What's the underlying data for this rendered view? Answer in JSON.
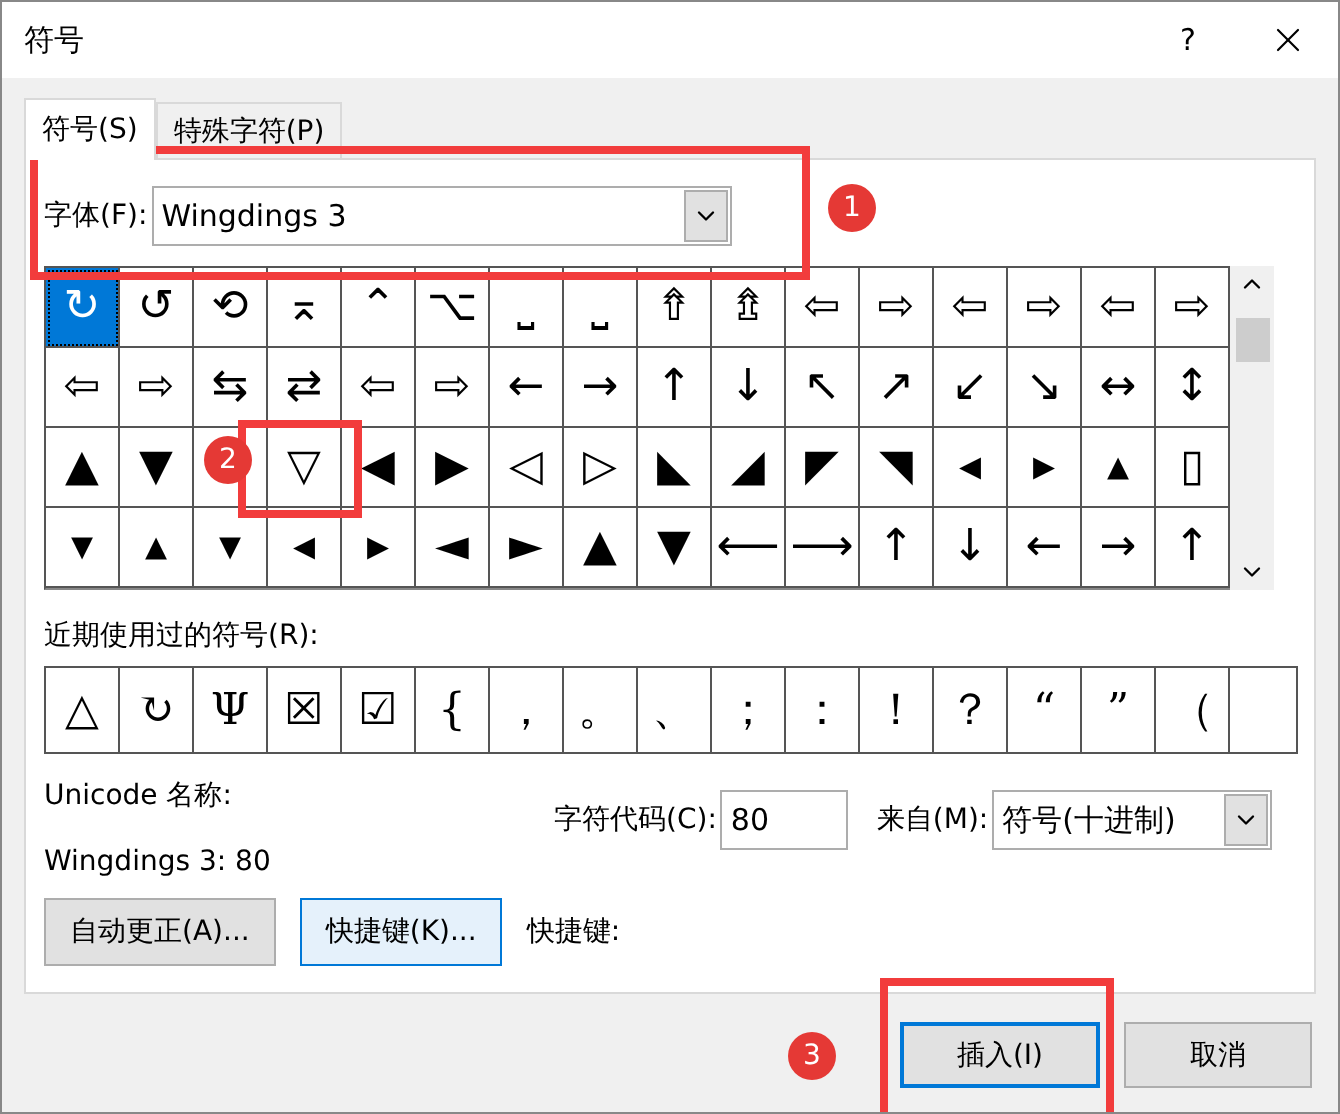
{
  "window": {
    "title": "符号",
    "help": "?"
  },
  "tabs": [
    {
      "label": "符号(S)",
      "selected": true
    },
    {
      "label": "特殊字符(P)",
      "selected": false
    }
  ],
  "font": {
    "label": "字体(F):",
    "value": "Wingdings 3"
  },
  "symbol_grid": {
    "rows": [
      [
        {
          "glyph": "↻",
          "selected": true
        },
        {
          "glyph": "↺",
          "selected": false
        },
        {
          "glyph": "⟲",
          "selected": false
        },
        {
          "glyph": "⌅",
          "selected": false
        },
        {
          "glyph": "⌃",
          "selected": false
        },
        {
          "glyph": "⌥",
          "selected": false
        },
        {
          "glyph": "⎵",
          "selected": false
        },
        {
          "glyph": "⎵",
          "selected": false
        },
        {
          "glyph": "⇮",
          "selected": false
        },
        {
          "glyph": "⇯",
          "selected": false
        },
        {
          "glyph": "⇦",
          "selected": false
        },
        {
          "glyph": "⇨",
          "selected": false
        },
        {
          "glyph": "⇦",
          "selected": false
        },
        {
          "glyph": "⇨",
          "selected": false
        },
        {
          "glyph": "⇦",
          "selected": false
        },
        {
          "glyph": "⇨",
          "selected": false
        }
      ],
      [
        {
          "glyph": "⇦",
          "selected": false
        },
        {
          "glyph": "⇨",
          "selected": false
        },
        {
          "glyph": "⇆",
          "selected": false
        },
        {
          "glyph": "⇄",
          "selected": false
        },
        {
          "glyph": "⇦",
          "selected": false
        },
        {
          "glyph": "⇨",
          "selected": false
        },
        {
          "glyph": "←",
          "selected": false
        },
        {
          "glyph": "→",
          "selected": false
        },
        {
          "glyph": "↑",
          "selected": false
        },
        {
          "glyph": "↓",
          "selected": false
        },
        {
          "glyph": "↖",
          "selected": false
        },
        {
          "glyph": "↗",
          "selected": false
        },
        {
          "glyph": "↙",
          "selected": false
        },
        {
          "glyph": "↘",
          "selected": false
        },
        {
          "glyph": "↔",
          "selected": false
        },
        {
          "glyph": "↕",
          "selected": false
        }
      ],
      [
        {
          "glyph": "▲",
          "selected": false
        },
        {
          "glyph": "▼",
          "selected": false
        },
        {
          "selected": false
        },
        {
          "glyph": "▽",
          "selected": false
        },
        {
          "glyph": "◀",
          "selected": false
        },
        {
          "glyph": "▶",
          "selected": false
        },
        {
          "glyph": "◁",
          "selected": false
        },
        {
          "glyph": "▷",
          "selected": false
        },
        {
          "glyph": "◣",
          "selected": false
        },
        {
          "glyph": "◢",
          "selected": false
        },
        {
          "glyph": "◤",
          "selected": false
        },
        {
          "glyph": "◥",
          "selected": false
        },
        {
          "glyph": "◂",
          "selected": false
        },
        {
          "glyph": "▸",
          "selected": false
        },
        {
          "glyph": "▴",
          "selected": false
        },
        {
          "glyph": "▯",
          "selected": false
        }
      ],
      [
        {
          "glyph": "▾",
          "selected": false
        },
        {
          "glyph": "▴",
          "selected": false
        },
        {
          "glyph": "▾",
          "selected": false
        },
        {
          "glyph": "◂",
          "selected": false
        },
        {
          "glyph": "▸",
          "selected": false
        },
        {
          "glyph": "◄",
          "selected": false
        },
        {
          "glyph": "►",
          "selected": false
        },
        {
          "glyph": "▲",
          "selected": false
        },
        {
          "glyph": "▼",
          "selected": false
        },
        {
          "glyph": "⟵",
          "selected": false
        },
        {
          "glyph": "⟶",
          "selected": false
        },
        {
          "glyph": "↑",
          "selected": false
        },
        {
          "glyph": "↓",
          "selected": false
        },
        {
          "glyph": "←",
          "selected": false
        },
        {
          "glyph": "→",
          "selected": false
        },
        {
          "glyph": "↑",
          "selected": false
        }
      ]
    ]
  },
  "recent": {
    "label": "近期使用过的符号(R):",
    "symbols": [
      "△",
      "↻",
      "Ψ",
      "☒",
      "☑",
      "{",
      "，",
      "。",
      "、",
      "；",
      "：",
      "！",
      "？",
      "“",
      "”",
      "（"
    ]
  },
  "unicode_name": {
    "label": "Unicode 名称:",
    "value": "Wingdings 3: 80"
  },
  "char_code": {
    "label": "字符代码(C):",
    "value": "80"
  },
  "from": {
    "label": "来自(M):",
    "value": "符号(十进制)"
  },
  "buttons": [
    {
      "label": "自动更正(A)...",
      "focused": false
    },
    {
      "label": "快捷键(K)...",
      "focused": true
    }
  ],
  "shortcut_label": "快捷键:",
  "footer_buttons": [
    {
      "label": "插入(I)",
      "default": true
    },
    {
      "label": "取消",
      "default": false
    }
  ],
  "annotations": [
    {
      "number": "1"
    },
    {
      "number": "2"
    },
    {
      "number": "3"
    }
  ]
}
